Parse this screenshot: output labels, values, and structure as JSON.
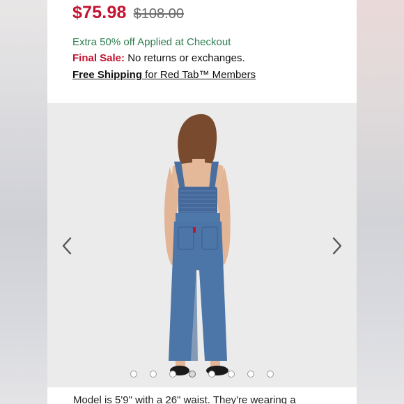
{
  "product": {
    "sale_price": "$75.98",
    "original_price": "$108.00"
  },
  "promo": {
    "text": "Extra 50% off Applied at Checkout"
  },
  "final_sale": {
    "label": "Final Sale:",
    "text": " No returns or exchanges."
  },
  "shipping": {
    "link_text": "Free Shipping",
    "text": " for Red Tab™ Members"
  },
  "gallery": {
    "prev_icon": "chevron-left-icon",
    "next_icon": "chevron-right-icon",
    "dot_count": 8,
    "active_index": 3
  },
  "description": {
    "text": "Model is 5'9\" with a 26\" waist. They're wearing a"
  },
  "colors": {
    "sale": "#c41230",
    "promo": "#2e7d4f",
    "denim": "#4d76a8"
  }
}
